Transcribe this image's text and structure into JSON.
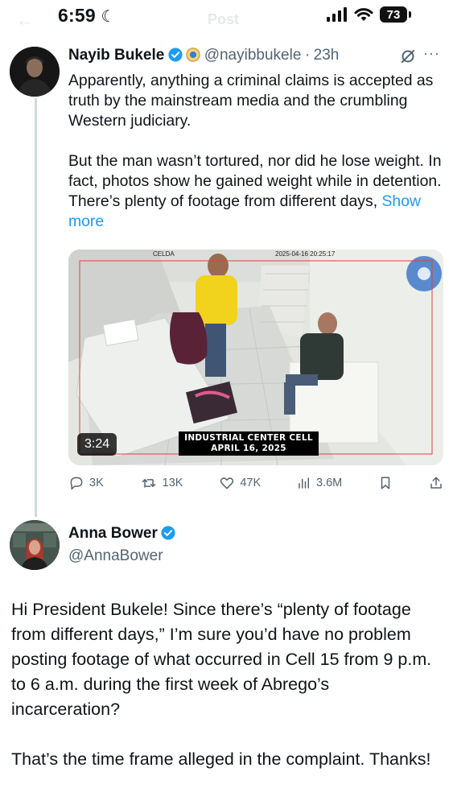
{
  "status_bar": {
    "time": "6:59",
    "battery": "73"
  },
  "header": {
    "title": "Post"
  },
  "post": {
    "author_name": "Nayib Bukele",
    "handle": "@nayibbukele",
    "separator": "·",
    "age": "23h",
    "text": "Apparently, anything a criminal claims is accepted as truth by the mainstream media and the crumbling Western judiciary.\n\nBut the man wasn’t tortured, nor did he lose weight. In fact, photos show he gained weight while in detention. There’s plenty of footage from different days,",
    "show_more": "Show more",
    "video": {
      "duration": "3:24",
      "cam_label": "CELDA",
      "cam_timestamp": "2025-04-16 20:25:17",
      "caption_line1": "INDUSTRIAL CENTER CELL",
      "caption_line2": "APRIL 16, 2025"
    },
    "stats": {
      "replies": "3K",
      "reposts": "13K",
      "likes": "47K",
      "views": "3.6M"
    }
  },
  "reply": {
    "author_name": "Anna Bower",
    "handle": "@AnnaBower",
    "text": "Hi President Bukele! Since there’s “plenty of footage from different days,” I’m sure you’d have no problem posting footage of what occurred in Cell 15 from 9 p.m. to 6 a.m. during the first week of Abrego’s incarceration?\n\nThat’s the time frame alleged in the complaint. Thanks!"
  },
  "colors": {
    "accent": "#1d9bf0",
    "verified": "#1d9bf0",
    "muted": "#536471",
    "thread_line": "#cfd9de"
  }
}
